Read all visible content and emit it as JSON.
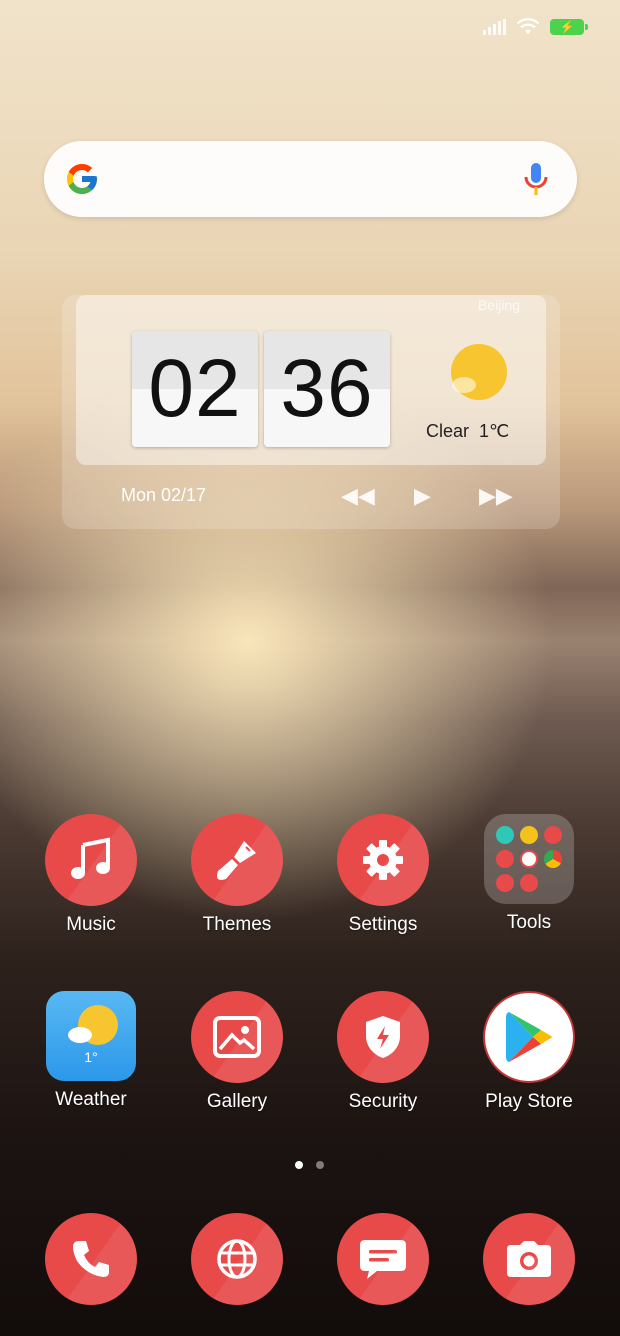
{
  "status": {
    "battery_icon": "battery-charging-icon",
    "wifi_icon": "wifi-icon",
    "signal_icon": "signal-icon"
  },
  "search": {
    "logo": "google-logo",
    "mic_icon": "mic-icon"
  },
  "widget": {
    "city": "Beijing",
    "hour": "02",
    "minute": "36",
    "condition": "Clear",
    "temperature": "1℃",
    "date": "Mon 02/17"
  },
  "apps": {
    "music": "Music",
    "themes": "Themes",
    "settings": "Settings",
    "tools": "Tools",
    "weather": "Weather",
    "weather_temp": "1°",
    "gallery": "Gallery",
    "security": "Security",
    "play_store": "Play Store"
  },
  "colors": {
    "accent": "#e84a4a",
    "battery": "#4bd34e",
    "weather_bg": "#2c98ea"
  }
}
